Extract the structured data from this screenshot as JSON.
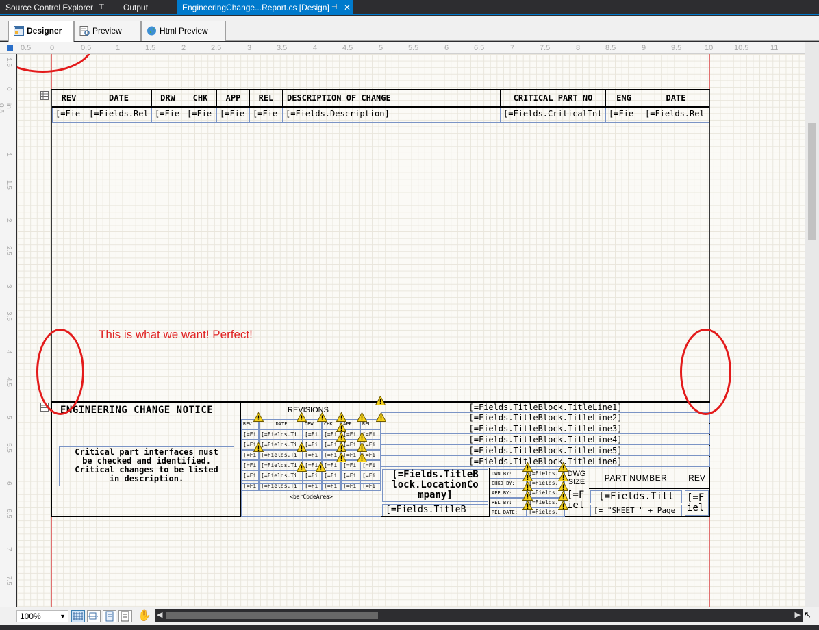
{
  "doc_tabs": [
    {
      "label": "Source Control Explorer"
    },
    {
      "label": "Output"
    },
    {
      "label": "EngineeringChange...Report.cs [Design]"
    }
  ],
  "designer_tabs": [
    {
      "label": "Designer"
    },
    {
      "label": "Preview"
    },
    {
      "label": "Html Preview"
    }
  ],
  "ruler_h": [
    "0.5",
    "0",
    "0.5",
    "1",
    "1.5",
    "2",
    "2.5",
    "3",
    "3.5",
    "4",
    "4.5",
    "5",
    "5.5",
    "6",
    "6.5",
    "7",
    "7.5",
    "8",
    "8.5",
    "9",
    "9.5",
    "10",
    "10.5",
    "11"
  ],
  "ruler_v": [
    "1.5",
    "0",
    "in 0.5",
    "1",
    "1.5",
    "2",
    "2.5",
    "3",
    "3.5",
    "4",
    "4.5",
    "5",
    "5.5",
    "6",
    "6.5",
    "7",
    "7.5"
  ],
  "header_band": {
    "columns": [
      "REV",
      "DATE",
      "DRW",
      "CHK",
      "APP",
      "REL",
      "DESCRIPTION OF CHANGE",
      "CRITICAL PART NO",
      "ENG",
      "DATE"
    ],
    "detail": [
      "[=Fie",
      "[=Fields.Rel",
      "[=Fie",
      "[=Fie",
      "[=Fie",
      "[=Fie",
      "[=Fields.Description]",
      "[=Fields.CriticalInt",
      "[=Fie",
      "[=Fields.Rel"
    ]
  },
  "annotation": "This is what we want! Perfect!",
  "footer": {
    "title": "ENGINEERING CHANGE NOTICE",
    "note_lines": [
      "Critical part interfaces must",
      "be checked and identified.",
      "Critical changes to be listed",
      "in description."
    ],
    "revisions_label": "REVISIONS",
    "rev_headers": [
      "REV",
      "DATE",
      "DRW",
      "CHK",
      "APP",
      "REL"
    ],
    "rev_row": [
      "[=Fi",
      "[=Fields.Ti",
      "[=Fi",
      "[=Fi",
      "[=Fi",
      "[=Fi"
    ],
    "barcode": "<barCodeArea>",
    "title_lines": [
      "[=Fields.TitleBlock.TitleLine1]",
      "[=Fields.TitleBlock.TitleLine2]",
      "[=Fields.TitleBlock.TitleLine3]",
      "[=Fields.TitleBlock.TitleLine4]",
      "[=Fields.TitleBlock.TitleLine5]",
      "[=Fields.TitleBlock.TitleLine6]"
    ],
    "location_lines": [
      "[=Fields.TitleB",
      "lock.LocationCo",
      "mpany]"
    ],
    "location_bottom": "[=Fields.TitleB",
    "sign_labels": [
      "DWN BY:",
      "CHKD BY:",
      "APP BY:",
      "REL BY:",
      "REL DATE:"
    ],
    "sign_value": "[=Fields.",
    "dwg_size": [
      "DWG",
      "SIZE"
    ],
    "dwg_val": [
      "[=F",
      "iel"
    ],
    "part_number_label": "PART NUMBER",
    "part_number_val": "[=Fields.Titl",
    "sheet_val": "[= \"SHEET \" + Page",
    "rev_label": "REV",
    "rev_val": [
      "[=F",
      "iel"
    ]
  },
  "zoom": "100%"
}
